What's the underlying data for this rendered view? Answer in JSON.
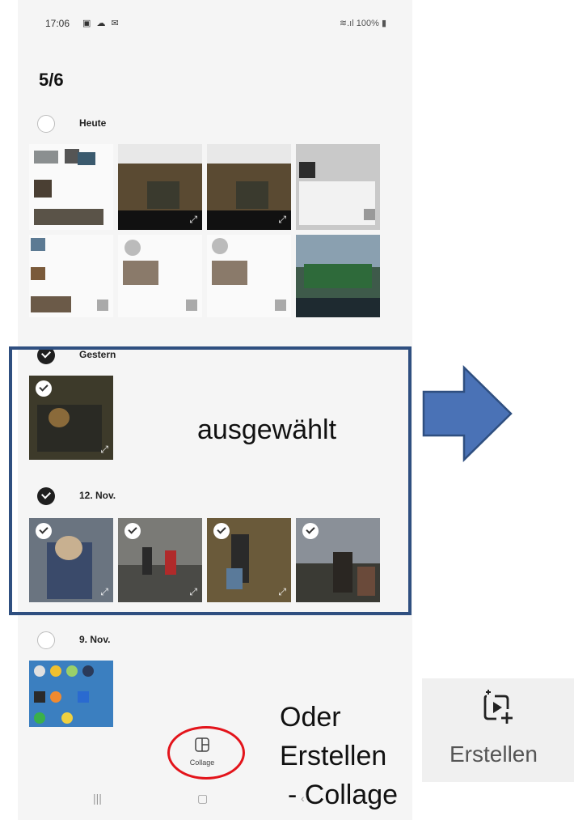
{
  "status_bar": {
    "time": "17:06",
    "notif_icons": "▣ ☁ ✉",
    "signal": "≋.ıl",
    "battery": "100%"
  },
  "selection_counter": "5/6",
  "sections": [
    {
      "label": "Heute",
      "checked": false
    },
    {
      "label": "Gestern",
      "checked": true
    },
    {
      "label": "12. Nov.",
      "checked": true
    },
    {
      "label": "9. Nov.",
      "checked": false
    }
  ],
  "annotation": {
    "selected_label": "ausgewählt",
    "oder_line1": "Oder",
    "oder_line2": "Erstellen",
    "oder_line3": "- Collage"
  },
  "bottom_bar": {
    "collage_label": "Collage"
  },
  "erstellen_panel": {
    "label": "Erstellen"
  },
  "colors": {
    "highlight_border": "#2f4f80",
    "arrow_fill": "#4a72b6",
    "red_ring": "#e3141b"
  }
}
